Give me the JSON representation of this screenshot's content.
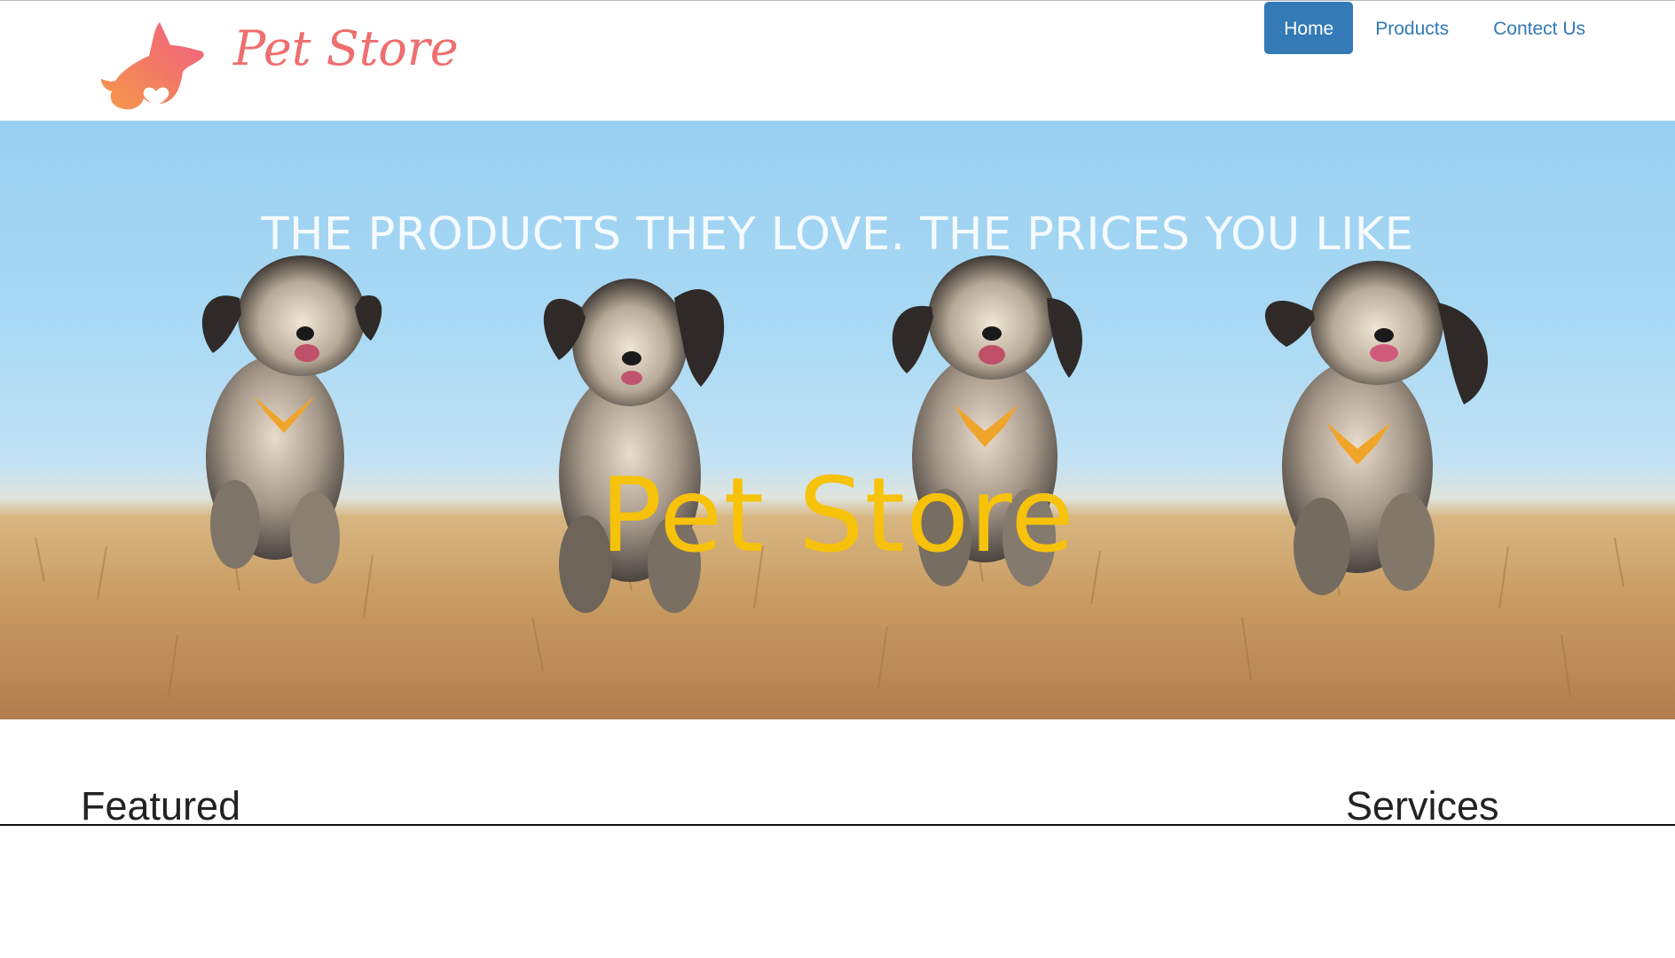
{
  "brand": {
    "name": "Pet Store",
    "logo_icon": "dog-silhouette-heart-icon",
    "color": "#ef6e6e"
  },
  "nav": {
    "items": [
      {
        "label": "Home",
        "active": true
      },
      {
        "label": "Products",
        "active": false
      },
      {
        "label": "Contect Us",
        "active": false
      }
    ],
    "accent": "#337ab7"
  },
  "hero": {
    "tagline": "THE PRODUCTS THEY LOVE. THE PRICES YOU LIKE",
    "title": "Pet Store",
    "title_color": "#f7c20a",
    "image": "four-dogs-running-in-field"
  },
  "sections": {
    "featured": "Featured",
    "services": "Services"
  }
}
